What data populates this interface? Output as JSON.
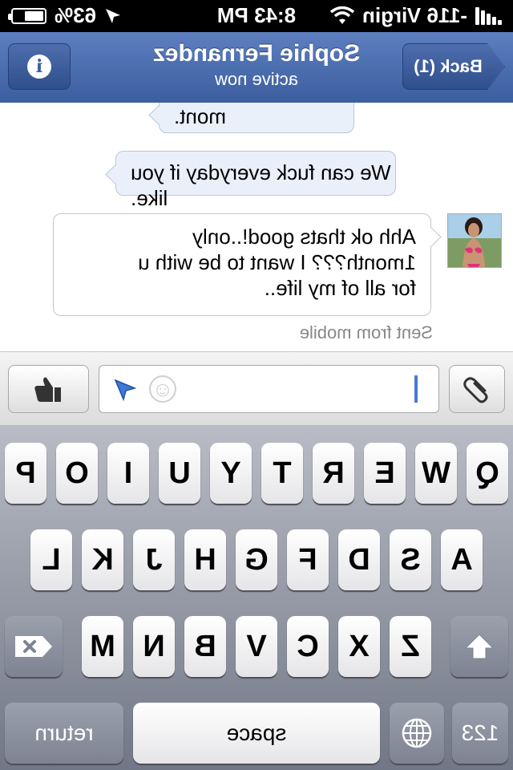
{
  "status_bar": {
    "carrier": "-116 Virgin",
    "time": "8:43 PM",
    "battery": "63%",
    "battery_level": 0.63,
    "icons": [
      "signal-bars-icon",
      "wifi-icon",
      "location-arrow-icon",
      "battery-icon"
    ]
  },
  "nav": {
    "back_label": "Back (1)",
    "title": "Sophie Fernandez",
    "subtitle": "active now",
    "info_icon": "info-icon"
  },
  "messages": [
    {
      "direction": "incoming",
      "text": "mont."
    },
    {
      "direction": "incoming",
      "text": "We can fuck everyday if you like."
    },
    {
      "direction": "outgoing",
      "lines": [
        "Ahh ok thats good!..only",
        "1month??? I want to be with u",
        "for all of my life.."
      ]
    }
  ],
  "sent_from": "Sent from mobile",
  "composer": {
    "value": "",
    "icons": [
      "attachment-icon",
      "smiley-icon",
      "location-arrow-icon",
      "thumbs-up-icon"
    ]
  },
  "keyboard": {
    "row1": [
      "Q",
      "W",
      "E",
      "R",
      "T",
      "Y",
      "U",
      "I",
      "O",
      "P"
    ],
    "row2": [
      "A",
      "S",
      "D",
      "F",
      "G",
      "H",
      "J",
      "K",
      "L"
    ],
    "row3": [
      "Z",
      "X",
      "C",
      "V",
      "B",
      "N",
      "M"
    ],
    "numbers_label": "123",
    "space_label": "space",
    "return_label": "return",
    "globe_icon": "globe-icon",
    "shift_icon": "shift-icon",
    "delete_icon": "delete-icon"
  }
}
